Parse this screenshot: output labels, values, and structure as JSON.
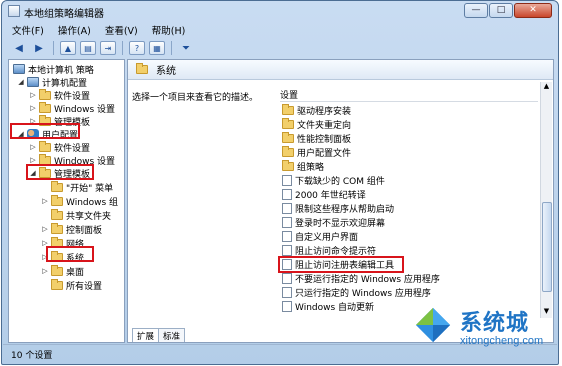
{
  "window": {
    "title": "本地组策略编辑器"
  },
  "menu": [
    "文件(F)",
    "操作(A)",
    "查看(V)",
    "帮助(H)"
  ],
  "tree": {
    "items": [
      {
        "label": "本地计算机 策略"
      },
      {
        "label": "计算机配置"
      },
      {
        "label": "软件设置"
      },
      {
        "label": "Windows 设置"
      },
      {
        "label": "管理模板"
      },
      {
        "label": "用户配置"
      },
      {
        "label": "软件设置"
      },
      {
        "label": "Windows 设置"
      },
      {
        "label": "管理模板"
      },
      {
        "label": "\"开始\" 菜单"
      },
      {
        "label": "Windows 组"
      },
      {
        "label": "共享文件夹"
      },
      {
        "label": "控制面板"
      },
      {
        "label": "网络"
      },
      {
        "label": "系统"
      },
      {
        "label": "桌面"
      },
      {
        "label": "所有设置"
      }
    ]
  },
  "right": {
    "header": "系统",
    "description": "选择一个项目来查看它的描述。",
    "column": "设置",
    "items": [
      {
        "label": "驱动程序安装"
      },
      {
        "label": "文件夹重定向"
      },
      {
        "label": "性能控制面板"
      },
      {
        "label": "用户配置文件"
      },
      {
        "label": "组策略"
      },
      {
        "label": "下载缺少的 COM 组件"
      },
      {
        "label": "2000 年世纪转译"
      },
      {
        "label": "限制这些程序从帮助启动"
      },
      {
        "label": "登录时不显示欢迎屏幕"
      },
      {
        "label": "自定义用户界面"
      },
      {
        "label": "阻止访问命令提示符"
      },
      {
        "label": "阻止访问注册表编辑工具"
      },
      {
        "label": "不要运行指定的 Windows 应用程序"
      },
      {
        "label": "只运行指定的 Windows 应用程序"
      },
      {
        "label": "Windows 自动更新"
      }
    ],
    "tabs": [
      "扩展",
      "标准"
    ]
  },
  "status": "10 个设置",
  "watermark": {
    "name": "系统城",
    "url": "xitongcheng.com"
  }
}
